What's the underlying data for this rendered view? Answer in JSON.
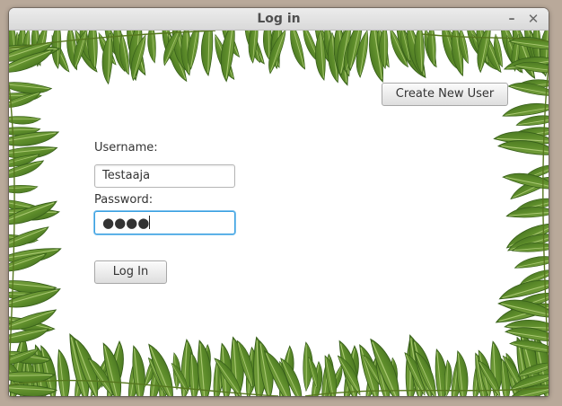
{
  "window": {
    "title": "Log in",
    "minimize_glyph": "–",
    "close_glyph": "✕"
  },
  "form": {
    "create_user_label": "Create New User",
    "username_label": "Username:",
    "username_value": "Testaaja",
    "password_label": "Password:",
    "password_masked": "●●●●",
    "login_label": "Log In"
  },
  "colors": {
    "fern_dark": "#3f6a1e",
    "fern_mid": "#5d8c2a",
    "fern_light": "#86ad4a",
    "focus_border": "#3aa0e0"
  }
}
